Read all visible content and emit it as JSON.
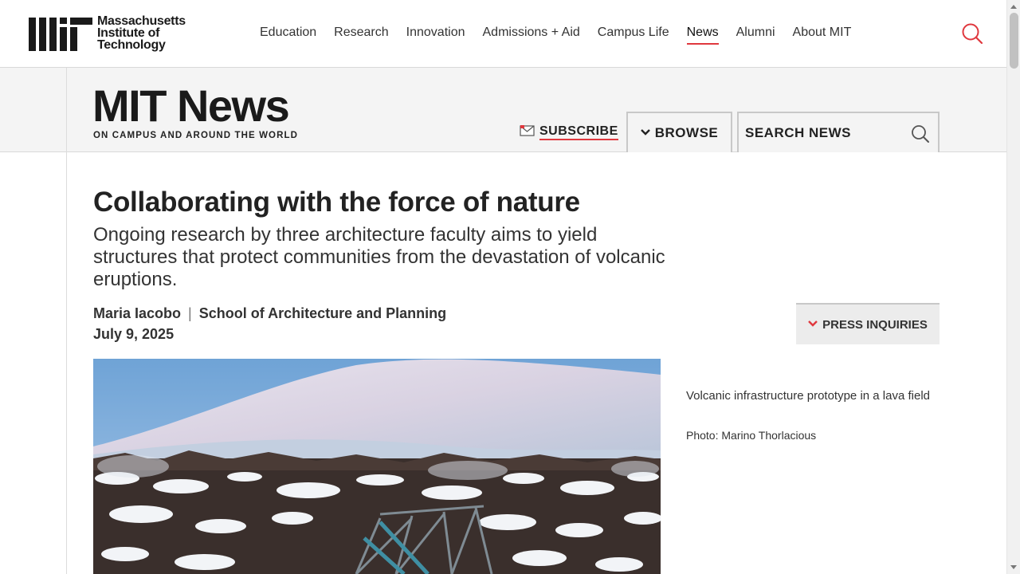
{
  "header": {
    "logo_lines": [
      "Massachusetts",
      "Institute of",
      "Technology"
    ],
    "nav_items": [
      {
        "label": "Education",
        "active": false
      },
      {
        "label": "Research",
        "active": false
      },
      {
        "label": "Innovation",
        "active": false
      },
      {
        "label": "Admissions + Aid",
        "active": false
      },
      {
        "label": "Campus Life",
        "active": false
      },
      {
        "label": "News",
        "active": true
      },
      {
        "label": "Alumni",
        "active": false
      },
      {
        "label": "About MIT",
        "active": false
      }
    ],
    "search_icon": "search-icon"
  },
  "news_header": {
    "title": "MIT News",
    "tagline": "ON CAMPUS AND AROUND THE WORLD",
    "subscribe_label": "SUBSCRIBE",
    "browse_label": "BROWSE",
    "search_placeholder": "SEARCH NEWS"
  },
  "article": {
    "headline": "Collaborating with the force of nature",
    "dek": "Ongoing research by three architecture faculty aims to yield structures that protect communities from the devastation of volcanic eruptions.",
    "author": "Maria Iacobo",
    "separator": "|",
    "department": "School of Architecture and Planning",
    "date": "July 9, 2025",
    "press_label": "PRESS INQUIRIES",
    "image_caption": "Volcanic infrastructure prototype in a lava field",
    "image_credit": "Photo: Marino Thorlacious"
  },
  "colors": {
    "accent": "#e0383e",
    "header_bg": "#f4f4f4",
    "text": "#222222"
  }
}
